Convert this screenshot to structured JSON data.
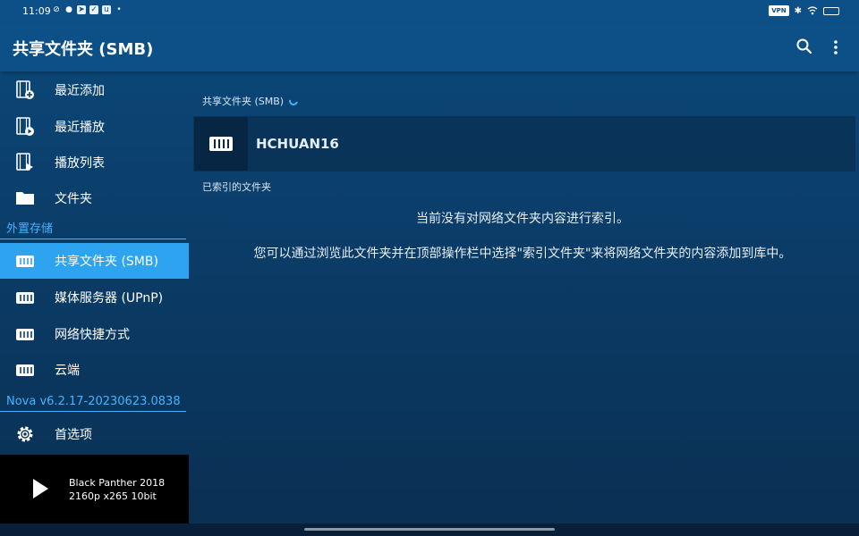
{
  "status_bar": {
    "time": "11:09",
    "left_icons": [
      "signal-off-icon",
      "wechat-icon",
      "telegram-icon",
      "app-icon",
      "app-icon",
      "dot-icon"
    ],
    "right_icons": [
      "vpn-icon",
      "bluetooth-icon",
      "wifi-icon",
      "battery-icon"
    ],
    "vpn_label": "VPN"
  },
  "toolbar": {
    "title": "共享文件夹 (SMB)",
    "icons": [
      "search-icon",
      "more-vert-icon"
    ]
  },
  "sidebar": {
    "items": [
      {
        "label": "最近添加",
        "icon": "film-add-icon"
      },
      {
        "label": "最近播放",
        "icon": "film-play-icon"
      },
      {
        "label": "播放列表",
        "icon": "film-list-icon"
      },
      {
        "label": "文件夹",
        "icon": "folder-icon"
      }
    ],
    "section_external": "外置存储",
    "external_items": [
      {
        "label": "共享文件夹 (SMB)",
        "icon": "nas-icon",
        "active": true
      },
      {
        "label": "媒体服务器 (UPnP)",
        "icon": "nas-icon"
      },
      {
        "label": "网络快捷方式",
        "icon": "nas-icon"
      },
      {
        "label": "云端",
        "icon": "nas-icon"
      }
    ],
    "section_version": "Nova v6.2.17-20230623.0838",
    "settings": {
      "label": "首选项",
      "icon": "gear-icon"
    }
  },
  "player": {
    "title": "Black Panther 2018",
    "subtitle": "2160p x265 10bit",
    "icon": "play-icon"
  },
  "main": {
    "breadcrumb": "共享文件夹 (SMB)",
    "server_name": "HCHUAN16",
    "indexed_header": "已索引的文件夹",
    "empty_message_1": "当前没有对网络文件夹内容进行索引。",
    "empty_message_2": "您可以通过浏览此文件夹并在顶部操作栏中选择\"索引文件夹\"来将网络文件夹的内容添加到库中。"
  },
  "colors": {
    "accent": "#2ea3f0",
    "section_text": "#46b3ff",
    "toolbar_bg": "#0d5087"
  }
}
